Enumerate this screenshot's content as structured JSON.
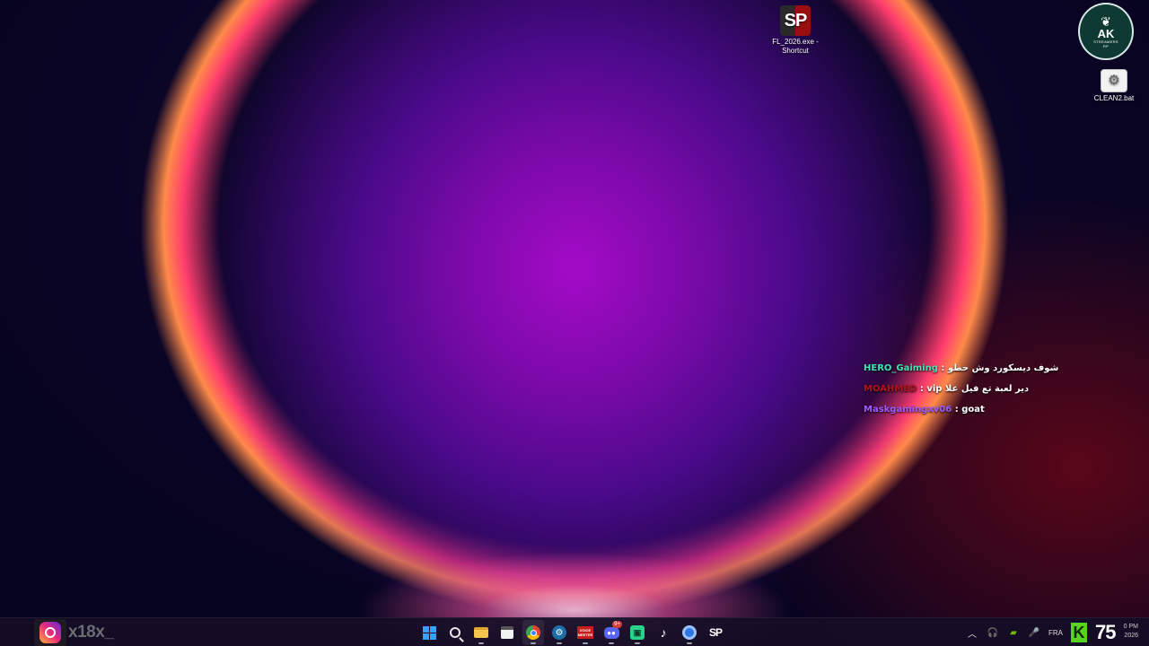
{
  "desktop": {
    "icons": [
      {
        "label_line1": "FL_2026.exe -",
        "label_line2": "Shortcut",
        "glyph": "SP"
      },
      {
        "label": "CLEAN2.bat",
        "glyph": "⚙"
      }
    ],
    "logo": {
      "main": "AK",
      "sub1": "STREAMERS",
      "sub2": "RP"
    }
  },
  "chat": {
    "lines": [
      {
        "user": "HERO_Gaiming",
        "sep": " : ",
        "message": "شوف ديسكورد وش حطو",
        "color": "#3fe6b6"
      },
      {
        "user": "MOAHMED",
        "sep": " : ",
        "message": "دير لعبة تع فيل علا vip",
        "color": "#b1121c"
      },
      {
        "user": "Maskgamingxv06",
        "sep": " : ",
        "message": "goat",
        "color": "#9c5cff"
      }
    ]
  },
  "taskbar": {
    "instagram_handle": "x18x_",
    "discord_badge": "9+",
    "voice_label_1": "VOICE",
    "voice_label_2": "MEETER",
    "sp_label": "SP",
    "tray": {
      "language": "FRA",
      "k_label": "K",
      "gauge_value": "75",
      "time": "0 PM",
      "date": "2026"
    }
  }
}
